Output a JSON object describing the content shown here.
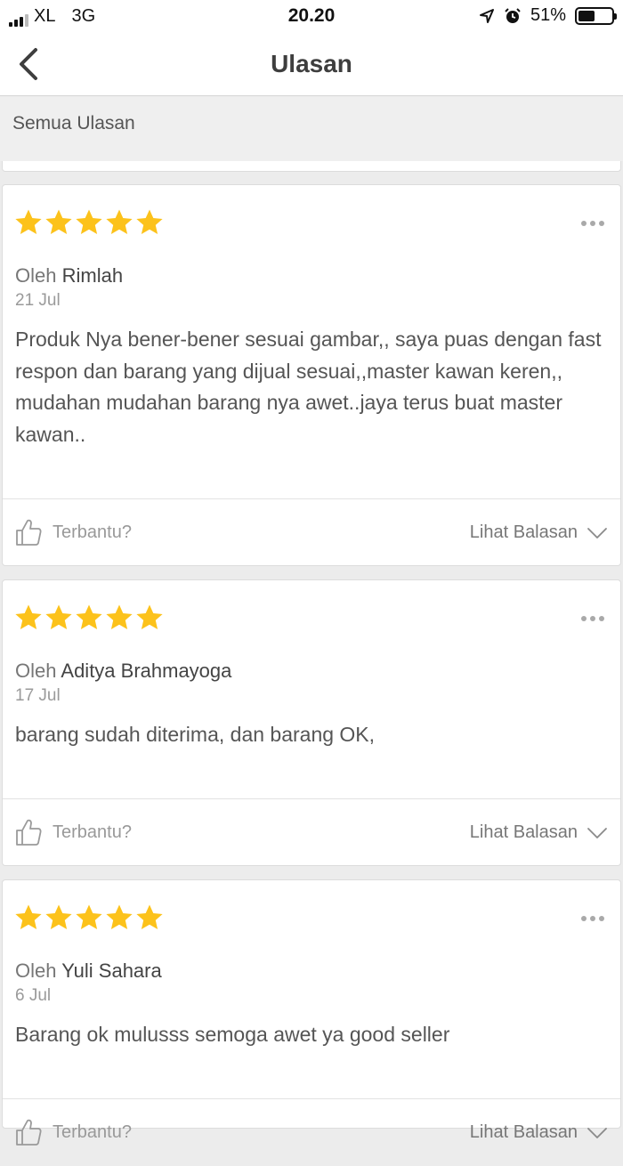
{
  "status_bar": {
    "carrier": "XL",
    "network": "3G",
    "time": "20.20",
    "battery": "51%",
    "battery_level": 0.51
  },
  "nav": {
    "title": "Ulasan",
    "back_icon": "chevron-left-icon"
  },
  "filter": {
    "label": "Semua Ulasan"
  },
  "reviews": [
    {
      "rating": 5,
      "by_prefix": "Oleh",
      "name": "Rimlah",
      "date": "21 Jul",
      "text": "Produk Nya bener-bener sesuai gambar,, saya puas dengan fast respon dan barang yang dijual sesuai,,master kawan keren,, mudahan mudahan barang nya awet..jaya terus buat master kawan..",
      "helpful_label": "Terbantu?",
      "replies_label": "Lihat Balasan"
    },
    {
      "rating": 5,
      "by_prefix": "Oleh",
      "name": "Aditya Brahmayoga",
      "date": "17 Jul",
      "text": "barang sudah diterima, dan  barang OK,",
      "helpful_label": "Terbantu?",
      "replies_label": "Lihat Balasan"
    },
    {
      "rating": 5,
      "by_prefix": "Oleh",
      "name": "Yuli Sahara",
      "date": "6 Jul",
      "text": "Barang ok mulusss semoga awet ya good seller",
      "helpful_label": "Terbantu?",
      "replies_label": "Lihat Balasan"
    }
  ],
  "colors": {
    "star": "#fcc21b",
    "background": "#ececec",
    "card": "#ffffff"
  }
}
